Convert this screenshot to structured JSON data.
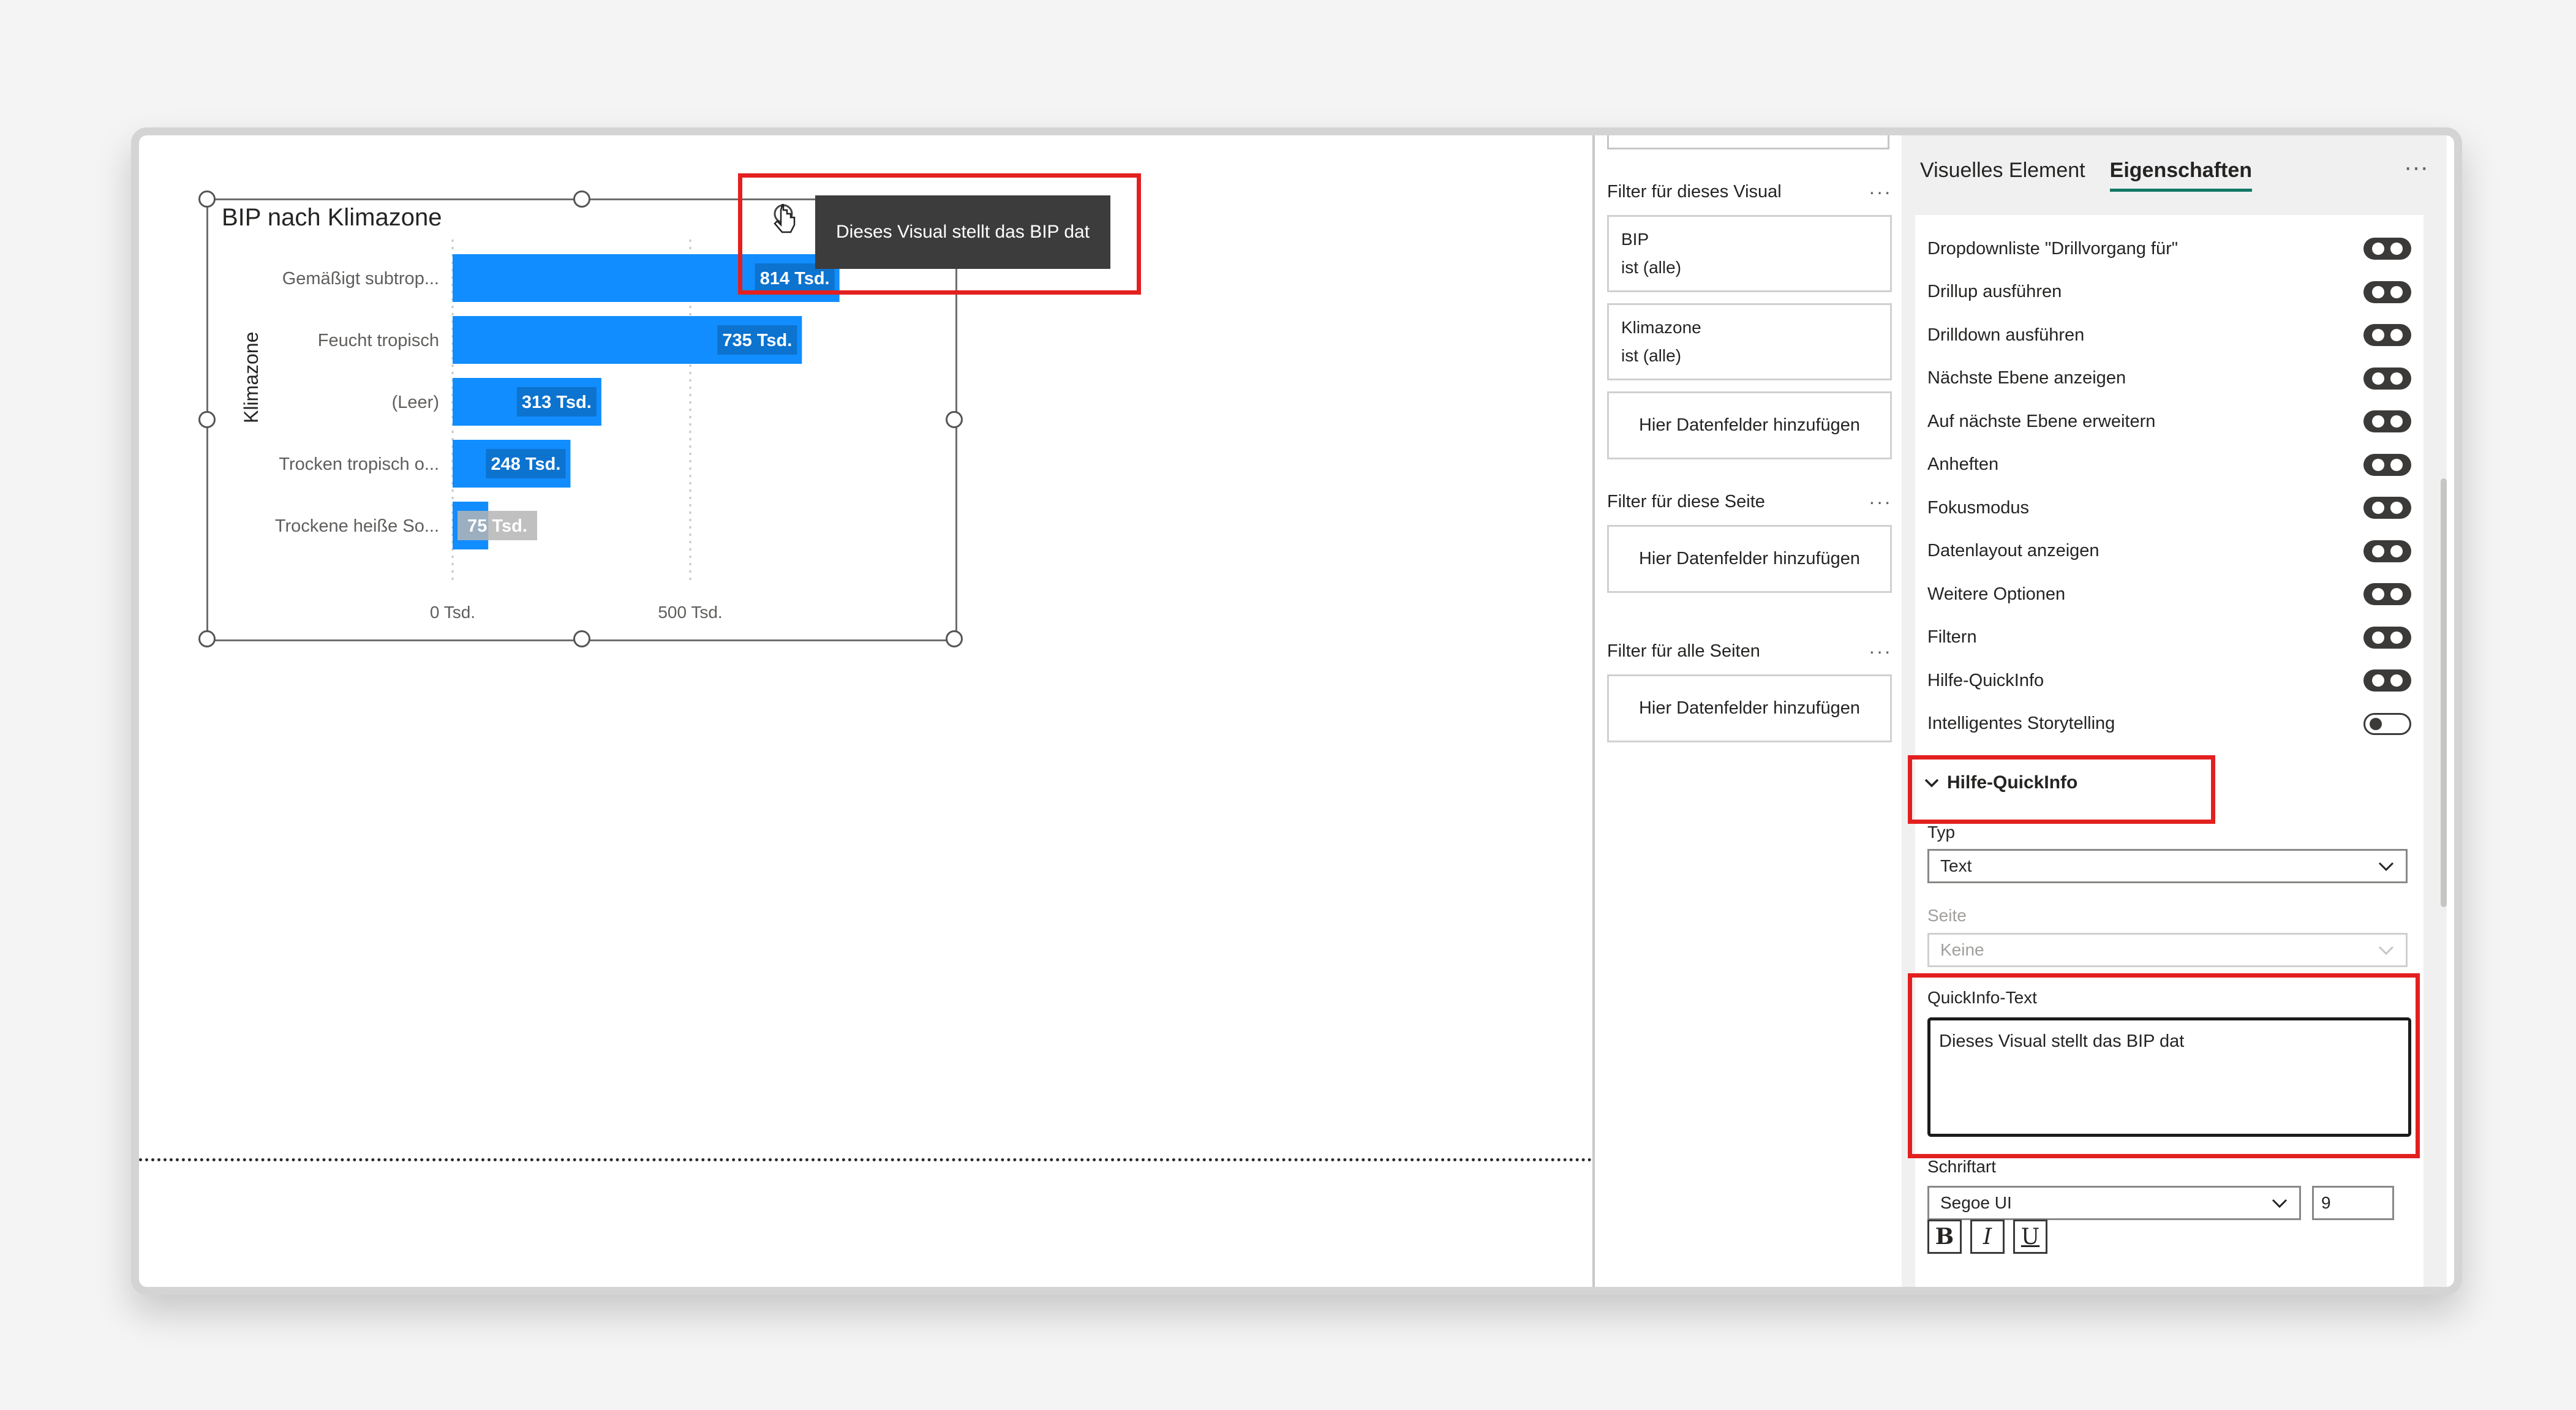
{
  "visual": {
    "title": "BIP nach Klimazone",
    "tooltip": "Dieses Visual stellt das BIP dat"
  },
  "chart_data": {
    "type": "bar",
    "title": "BIP nach Klimazone",
    "ylabel": "Klimazone",
    "xlabel": "",
    "categories": [
      "Gemäßigt subtrop...",
      "Feucht tropisch",
      "(Leer)",
      "Trocken tropisch o...",
      "Trockene heiße So..."
    ],
    "values": [
      814000,
      735000,
      313000,
      248000,
      75000
    ],
    "data_labels": [
      "814 Tsd.",
      "735 Tsd.",
      "313 Tsd.",
      "248 Tsd.",
      "75 Tsd."
    ],
    "x_ticks": [
      {
        "value": 0,
        "label": "0 Tsd."
      },
      {
        "value": 500000,
        "label": "500 Tsd."
      }
    ],
    "xlim": [
      0,
      1100000
    ],
    "color": "#118dff"
  },
  "filters": {
    "visual_section": "Filter für dieses Visual",
    "cards": [
      {
        "name": "BIP",
        "state": "ist (alle)"
      },
      {
        "name": "Klimazone",
        "state": "ist (alle)"
      }
    ],
    "add_fields": "Hier Datenfelder hinzufügen",
    "page_section": "Filter für diese Seite",
    "all_pages_section": "Filter für alle Seiten",
    "more": "···"
  },
  "format_pane": {
    "tabs": [
      "Visuelles Element",
      "Eigenschaften"
    ],
    "active_tab": "Eigenschaften",
    "more": "···",
    "header_icons": [
      {
        "label": "Dropdownliste \"Drillvorgang für\"",
        "on": true
      },
      {
        "label": "Drillup ausführen",
        "on": true
      },
      {
        "label": "Drilldown ausführen",
        "on": true
      },
      {
        "label": "Nächste Ebene anzeigen",
        "on": true
      },
      {
        "label": "Auf nächste Ebene erweitern",
        "on": true
      },
      {
        "label": "Anheften",
        "on": true
      },
      {
        "label": "Fokusmodus",
        "on": true
      },
      {
        "label": "Datenlayout anzeigen",
        "on": true
      },
      {
        "label": "Weitere Optionen",
        "on": true
      },
      {
        "label": "Filtern",
        "on": true
      },
      {
        "label": "Hilfe-QuickInfo",
        "on": true
      },
      {
        "label": "Intelligentes Storytelling",
        "on": false
      }
    ],
    "help_section": {
      "title": "Hilfe-QuickInfo",
      "type_label": "Typ",
      "type_value": "Text",
      "page_label": "Seite",
      "page_value": "Keine",
      "text_label": "QuickInfo-Text",
      "text_value": "Dieses Visual stellt das BIP dat",
      "font_label": "Schriftart",
      "font_value": "Segoe UI",
      "font_size": "9",
      "bold": "B",
      "italic": "I",
      "underline": "U"
    }
  }
}
